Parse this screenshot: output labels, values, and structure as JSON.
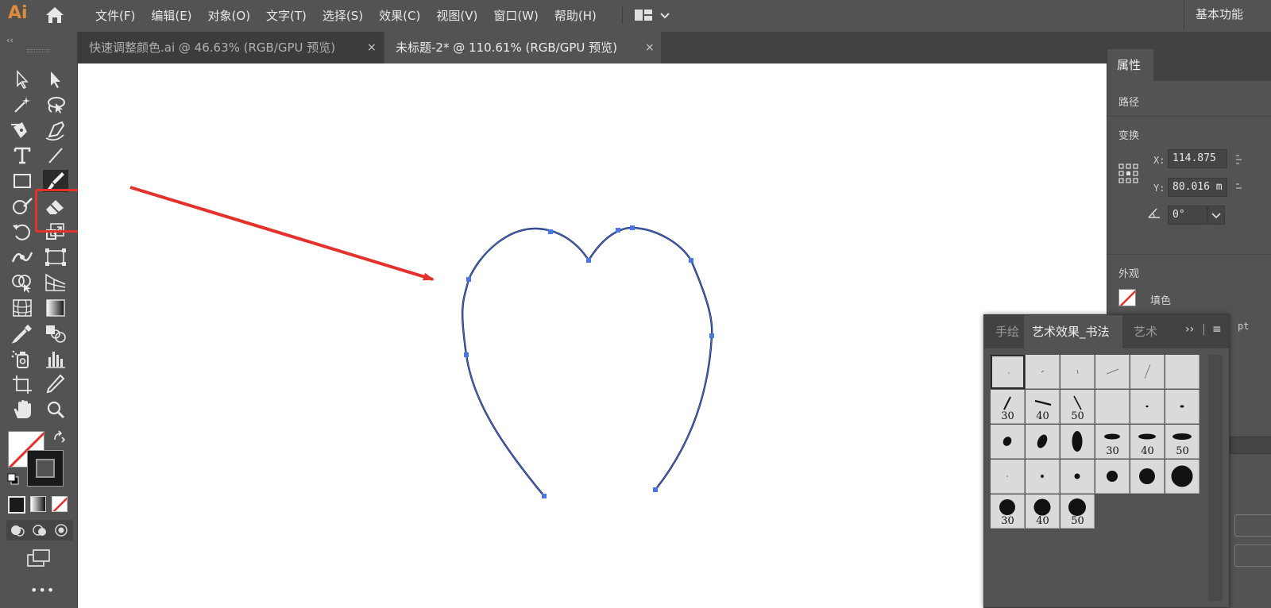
{
  "app": {
    "logo": "Ai"
  },
  "menu": {
    "items": [
      "文件(F)",
      "编辑(E)",
      "对象(O)",
      "文字(T)",
      "选择(S)",
      "效果(C)",
      "视图(V)",
      "窗口(W)",
      "帮助(H)"
    ],
    "workspace": "基本功能"
  },
  "toolbar": {
    "collapse_label": "‹‹"
  },
  "tabs": [
    {
      "label": "快速调整颜色.ai @ 46.63% (RGB/GPU 预览)",
      "close": "×",
      "active": false
    },
    {
      "label": "未标题-2* @ 110.61% (RGB/GPU 预览)",
      "close": "×",
      "active": true
    }
  ],
  "properties": {
    "tab": "属性",
    "section_path": "路径",
    "section_transform": "变换",
    "x_label": "X:",
    "x_value": "114.875 ",
    "y_label": "Y:",
    "y_value": "80.016 m",
    "angle_value": "0°",
    "section_appearance": "外观",
    "fill_label": "填色",
    "partial_pt": "pt"
  },
  "brushes": {
    "tabs": [
      "手绘",
      "艺术效果_书法",
      "艺术"
    ],
    "expand": "››",
    "menu": "≡",
    "cells": [
      {
        "label": ""
      },
      {
        "label": ""
      },
      {
        "label": ""
      },
      {
        "label": ""
      },
      {
        "label": ""
      },
      {
        "label": ""
      },
      {
        "label": "30"
      },
      {
        "label": "40"
      },
      {
        "label": "50"
      },
      {
        "label": ""
      },
      {
        "label": ""
      },
      {
        "label": ""
      },
      {
        "label": ""
      },
      {
        "label": ""
      },
      {
        "label": ""
      },
      {
        "label": "30"
      },
      {
        "label": "40"
      },
      {
        "label": "50"
      },
      {
        "label": ""
      },
      {
        "label": ""
      },
      {
        "label": ""
      },
      {
        "label": ""
      },
      {
        "label": ""
      },
      {
        "label": ""
      },
      {
        "label": "30"
      },
      {
        "label": "40"
      },
      {
        "label": "50"
      }
    ]
  },
  "colors": {
    "accent_logo": "#e08b39",
    "highlight": "#e4312b",
    "path_stroke": "#1f2a55",
    "anchor": "#4a78e0"
  }
}
